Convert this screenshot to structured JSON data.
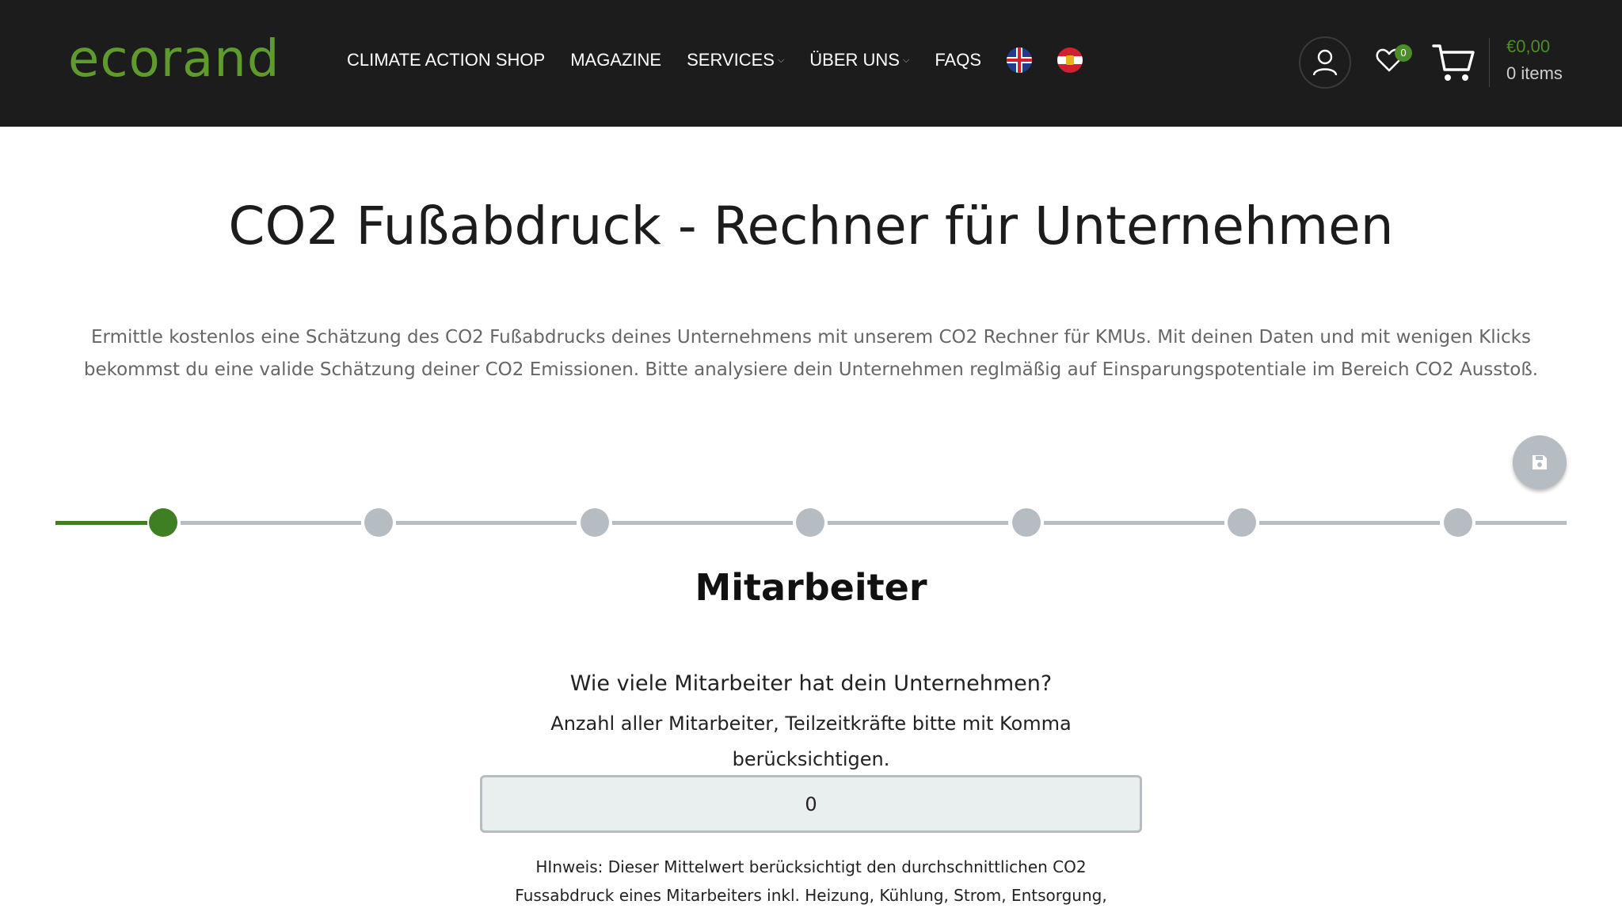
{
  "header": {
    "logo": "ecorand",
    "nav": [
      {
        "label": "CLIMATE ACTION SHOP",
        "has_dropdown": false
      },
      {
        "label": "MAGAZINE",
        "has_dropdown": false
      },
      {
        "label": "SERVICES",
        "has_dropdown": true
      },
      {
        "label": "ÜBER UNS",
        "has_dropdown": true
      },
      {
        "label": "FAQS",
        "has_dropdown": false
      }
    ],
    "languages": [
      "en-flag-icon",
      "de-at-flag-icon"
    ],
    "wishlist_count": "0",
    "cart_total": "€0,00",
    "cart_items": "0 items"
  },
  "main": {
    "title": "CO2 Fußabdruck - Rechner für Unternehmen",
    "intro": "Ermittle kostenlos eine Schätzung des CO2 Fußabdrucks deines Unternehmens mit unserem CO2 Rechner für KMUs. Mit deinen Daten und mit wenigen Klicks bekommst du eine valide Schätzung deiner CO2 Emissionen. Bitte analysiere dein Unternehmen reglmäßig auf Einsparungspotentiale im Bereich CO2 Ausstoß.",
    "stepper": {
      "total_steps": 7,
      "current_step": 1
    },
    "section_title": "Mitarbeiter",
    "question": "Wie viele Mitarbeiter hat dein Unternehmen?",
    "hint": "Anzahl aller Mitarbeiter, Teilzeitkräfte bitte mit Komma berücksichtigen.",
    "employee_value": "0",
    "note": "HInweis: Dieser Mittelwert berücksichtigt den durchschnittlichen CO2 Fussabdruck eines Mitarbeiters inkl. Heizung, Kühlung, Strom, Entsorgung,"
  },
  "colors": {
    "header_bg": "#1c1c1c",
    "brand_green": "#5e9b2c",
    "active_step": "#3f7f24",
    "inactive_step": "#b5bcc2"
  }
}
